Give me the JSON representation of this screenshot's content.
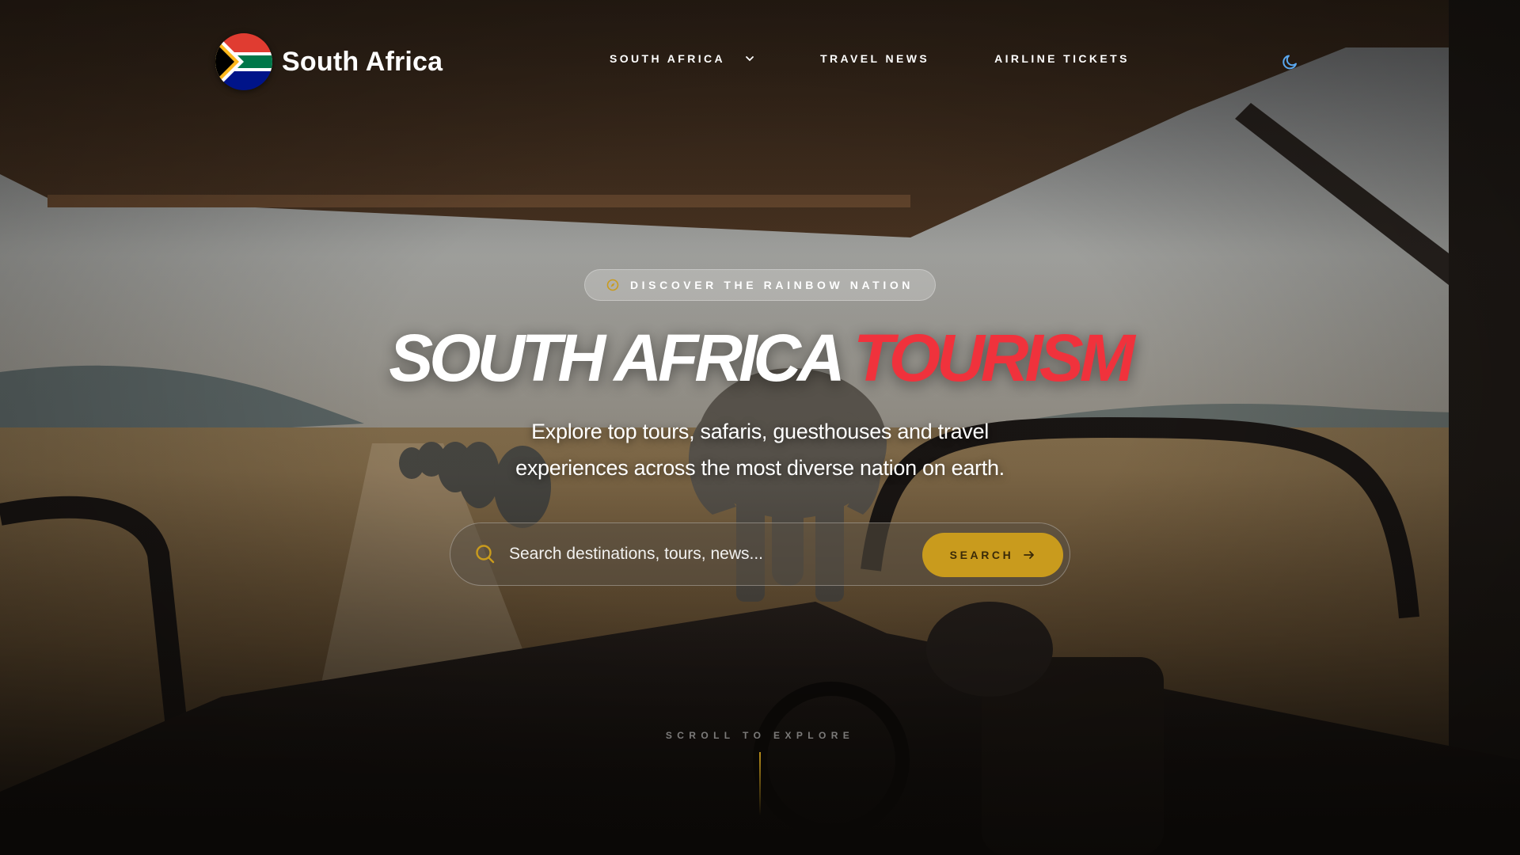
{
  "brand": {
    "name": "South Africa"
  },
  "nav": {
    "items": [
      {
        "label": "South Africa",
        "has_dropdown": true
      },
      {
        "label": "Travel News",
        "has_dropdown": false
      },
      {
        "label": "Airline Tickets",
        "has_dropdown": false
      }
    ],
    "theme_toggle_icon": "moon-icon"
  },
  "hero": {
    "badge": "Discover the Rainbow Nation",
    "title_white": "SOUTH AFRICA",
    "title_red": "TOURISM",
    "subtitle_line1": "Explore top tours, safaris, guesthouses and travel",
    "subtitle_line2": "experiences across the most diverse nation on earth.",
    "search": {
      "placeholder": "Search destinations, tours, news...",
      "button_label": "Search"
    },
    "scroll_hint": "Scroll to explore"
  },
  "colors": {
    "accent_gold": "#c99b1d",
    "accent_red": "#f0323c",
    "theme_icon_blue": "#5aa8f0"
  }
}
